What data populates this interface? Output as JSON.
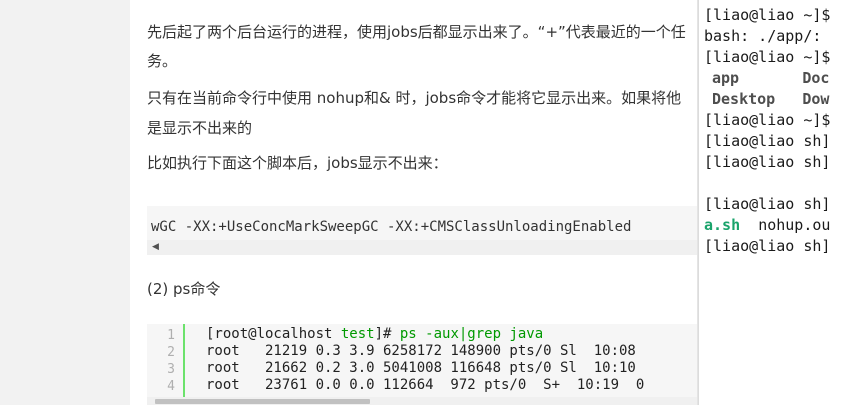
{
  "article": {
    "para1_line1": "先后起了两个后台运行的进程，使用jobs后都显示出来了。“+”代表最近的一个任",
    "para1_line2": "务。",
    "para2_line1": "只有在当前命令行中使用 nohup和& 时，jobs命令才能将它显示出来。如果将他",
    "para2_line2": "是显示不出来的",
    "para3": " 比如执行下面这个脚本后，jobs显示不出来：",
    "code_snippet": "wGC -XX:+UseConcMarkSweepGC -XX:+CMSClassUnloadingEnabled",
    "section_heading": "(2) ps命令",
    "listing": {
      "line_numbers": [
        "1",
        "2",
        "3",
        "4"
      ],
      "line1": {
        "prefix": "[root@localhost ",
        "dir": "test",
        "suffix": "]",
        "prompt": "# ",
        "cmd": "ps -aux|grep java"
      },
      "line2": "root   21219 0.3 3.9 6258172 148900 pts/0 Sl  10:08",
      "line3": "root   21662 0.2 3.0 5041008 116648 pts/0 Sl  10:10",
      "line4": "root   23761 0.0 0.0 112664  972 pts/0  S+  10:19  0"
    }
  },
  "terminal": {
    "lines": [
      "[liao@liao ~]$",
      "bash: ./app/:",
      "[liao@liao ~]$"
    ],
    "ls_row1": {
      "a": "app",
      "b": "Doc"
    },
    "ls_row2": {
      "a": "Desktop",
      "b": "Dow"
    },
    "lines2": [
      "[liao@liao ~]$",
      "[liao@liao sh]",
      "[liao@liao sh]",
      "",
      "[liao@liao sh]"
    ],
    "exec_file": "a.sh",
    "other_file": "nohup.ou",
    "last_line": "[liao@liao sh]"
  }
}
